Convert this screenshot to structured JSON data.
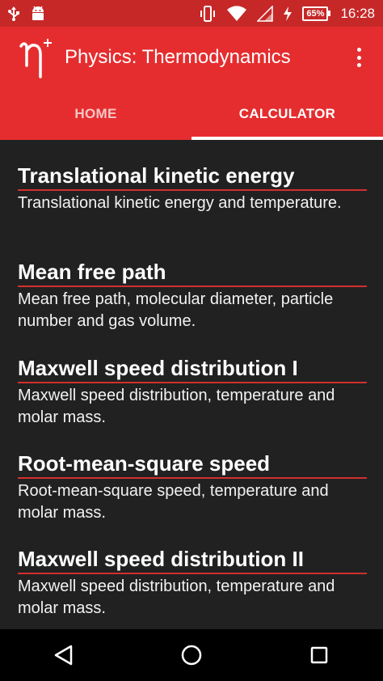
{
  "status_bar": {
    "time": "16:28",
    "battery_percent": "65%",
    "icons": [
      "usb-icon",
      "android-debug-icon",
      "vibrate-icon",
      "wifi-icon",
      "signal-icon",
      "charging-icon",
      "battery-icon"
    ]
  },
  "app_bar": {
    "logo_text": "η+",
    "title": "Physics: Thermodynamics",
    "menu_icon": "overflow-menu-icon"
  },
  "tabs": [
    {
      "label": "HOME",
      "active": false
    },
    {
      "label": "CALCULATOR",
      "active": true
    }
  ],
  "items": [
    {
      "title": "Translational kinetic energy",
      "description": "Translational kinetic energy and temperature."
    },
    {
      "title": "Mean free path",
      "description": "Mean free path, molecular diameter, particle number and gas volume."
    },
    {
      "title": "Maxwell speed distribution I",
      "description": "Maxwell speed distribution, temperature and molar mass."
    },
    {
      "title": "Root-mean-square speed",
      "description": "Root-mean-square speed, temperature and molar mass."
    },
    {
      "title": "Maxwell speed distribution II",
      "description": "Maxwell speed distribution, temperature and molar mass."
    }
  ],
  "nav_bar": {
    "buttons": [
      "back-icon",
      "home-icon",
      "recents-icon"
    ]
  },
  "colors": {
    "status_bar": "#c62828",
    "app_bar": "#e52d2f",
    "background": "#212121",
    "underline": "#d32f2f"
  }
}
